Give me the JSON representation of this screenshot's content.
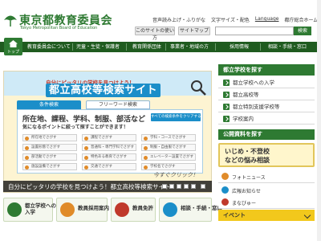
{
  "header": {
    "logo_title": "東京都教育委員会",
    "logo_subtitle": "Tokyo Metropolitan Board of Education",
    "utility_links": [
      "音声読み上げ・ふりがな",
      "文字サイズ・配色",
      "Language",
      "都庁総合ホームページ"
    ],
    "usage_label": "このサイトの使い方",
    "sitemap_label": "サイトマップ",
    "search_button": "検索",
    "search_value": ""
  },
  "nav": {
    "home_label": "トップ",
    "items": [
      "教育委員会について",
      "児童・生徒・保護者",
      "教育関係団体",
      "事業者・地域の方",
      "採用情報",
      "相談・手続・窓口"
    ]
  },
  "banner": {
    "pre_title": "自分にピッタリの学校を見つけよう！",
    "title": "都立高校等検索サイト",
    "tab_condition": "条件検索",
    "tab_freeword": "フリーワード検索",
    "line1": "所在地、課程、学科、制服、部活など",
    "line2": "気になるポイントに絞って探すことができます！",
    "clear_label": "すべての検索条件をクリアする",
    "conditions": [
      "所在地でさがす",
      "課程でさがす",
      "学科・コースでさがす",
      "設置形態でさがす",
      "普通科・専門学科でさがす",
      "制服・自由服でさがす",
      "部活動でさがす",
      "特色ある教育でさがす",
      "エレベーター設置でさがす",
      "施設設備でさがす",
      "交通でさがす",
      "学校名でさがす"
    ],
    "hint": "今すぐクリック！",
    "caption": "自分にピッタリの学校を見つけよう！都立高校等検索サイト"
  },
  "bottom_cards": [
    {
      "label_1": "都立学校への",
      "label_2": "入学",
      "icon": "school-icon"
    },
    {
      "label_1": "教員採用案内",
      "label_2": "",
      "icon": "teacher-icon"
    },
    {
      "label_1": "教員免許",
      "label_2": "",
      "icon": "license-icon"
    },
    {
      "label_1": "相談・手続・窓口",
      "label_2": "",
      "icon": "consult-icon"
    }
  ],
  "sidebar": {
    "title_1": "都立学校を探す",
    "items": [
      "都立学校への入学",
      "都立高校等",
      "都立特別支援学校等",
      "学校案内"
    ],
    "title_2": "公開資料を探す",
    "ijime_1": "いじめ・不登校",
    "ijime_2": "などの悩み相談",
    "links": [
      "フォトニュース",
      "広報お知らせ",
      "まなびゅー"
    ],
    "event": "イベント"
  },
  "colors": {
    "brand_green": "#2e7a32",
    "nav_dark": "#1f5b1f",
    "banner_blue": "#1b8ec9",
    "event_yellow": "#f2c81c"
  }
}
